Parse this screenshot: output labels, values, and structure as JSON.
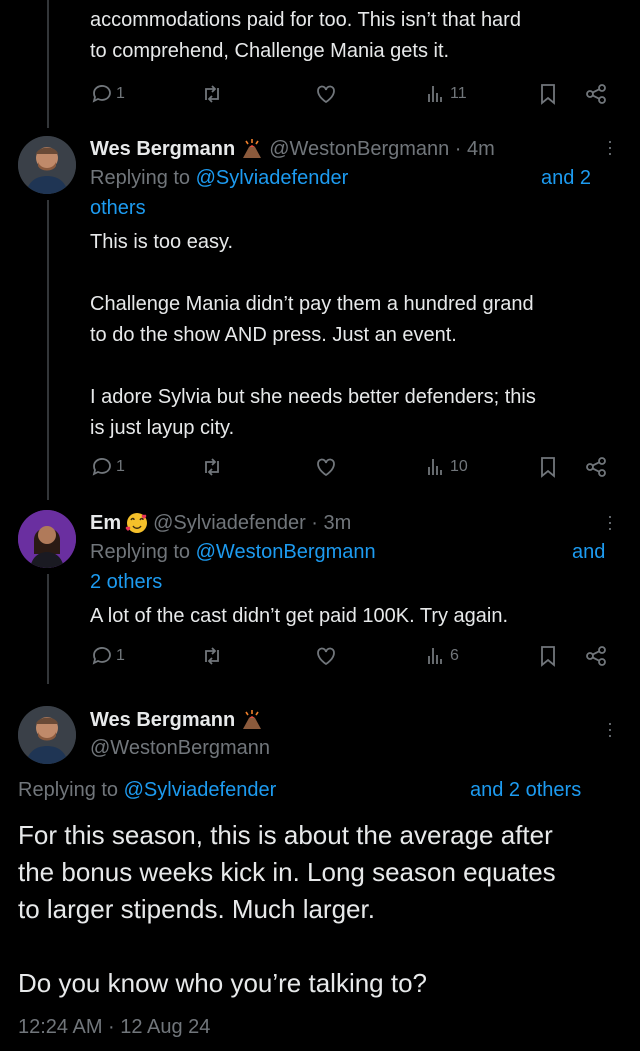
{
  "tweet0": {
    "body_lines": [
      "accommodations paid for too. This isn’t that hard",
      "to comprehend, Challenge Mania gets it."
    ],
    "replies": "1",
    "views": "11"
  },
  "tweet1": {
    "name": "Wes Bergmann",
    "handle_time": "@WestonBergmann · 4m",
    "replying_prefix": "Replying to",
    "replying_handle": "@Sylviadefender",
    "and_text": "and 2",
    "others_text": "others",
    "body_lines": [
      "This is too easy.",
      "",
      "Challenge Mania didn’t pay them a hundred grand",
      "to do the show AND press. Just an event.",
      "",
      "I adore Sylvia but she needs better defenders; this",
      "is just layup city."
    ],
    "replies": "1",
    "views": "10"
  },
  "tweet2": {
    "name": "Em",
    "handle_time": "@Sylviadefender · 3m",
    "replying_prefix": "Replying to",
    "replying_handle": "@WestonBergmann",
    "and_text": "and",
    "others_text": "2 others",
    "body": "A lot of the cast didn’t get paid 100K. Try again.",
    "replies": "1",
    "views": "6"
  },
  "main": {
    "name": "Wes Bergmann",
    "handle": "@WestonBergmann",
    "replying_prefix": "Replying to",
    "replying_handle": "@Sylviadefender",
    "and_others": "and 2 others",
    "body_lines": [
      "For this season, this is about the average after",
      "the bonus weeks kick in. Long season equates",
      "to larger stipends. Much larger.",
      "",
      "Do you know who you’re talking to?"
    ],
    "timestamp": "12:24 AM · 12 Aug 24"
  },
  "colors": {
    "background": "#000000",
    "text": "#e7e9ea",
    "muted": "#71767b",
    "link": "#1d9bf0"
  },
  "icons": [
    "reply-icon",
    "retweet-icon",
    "like-icon",
    "views-icon",
    "bookmark-icon",
    "share-icon",
    "more-icon",
    "volcano-emoji",
    "heart-face-emoji"
  ]
}
